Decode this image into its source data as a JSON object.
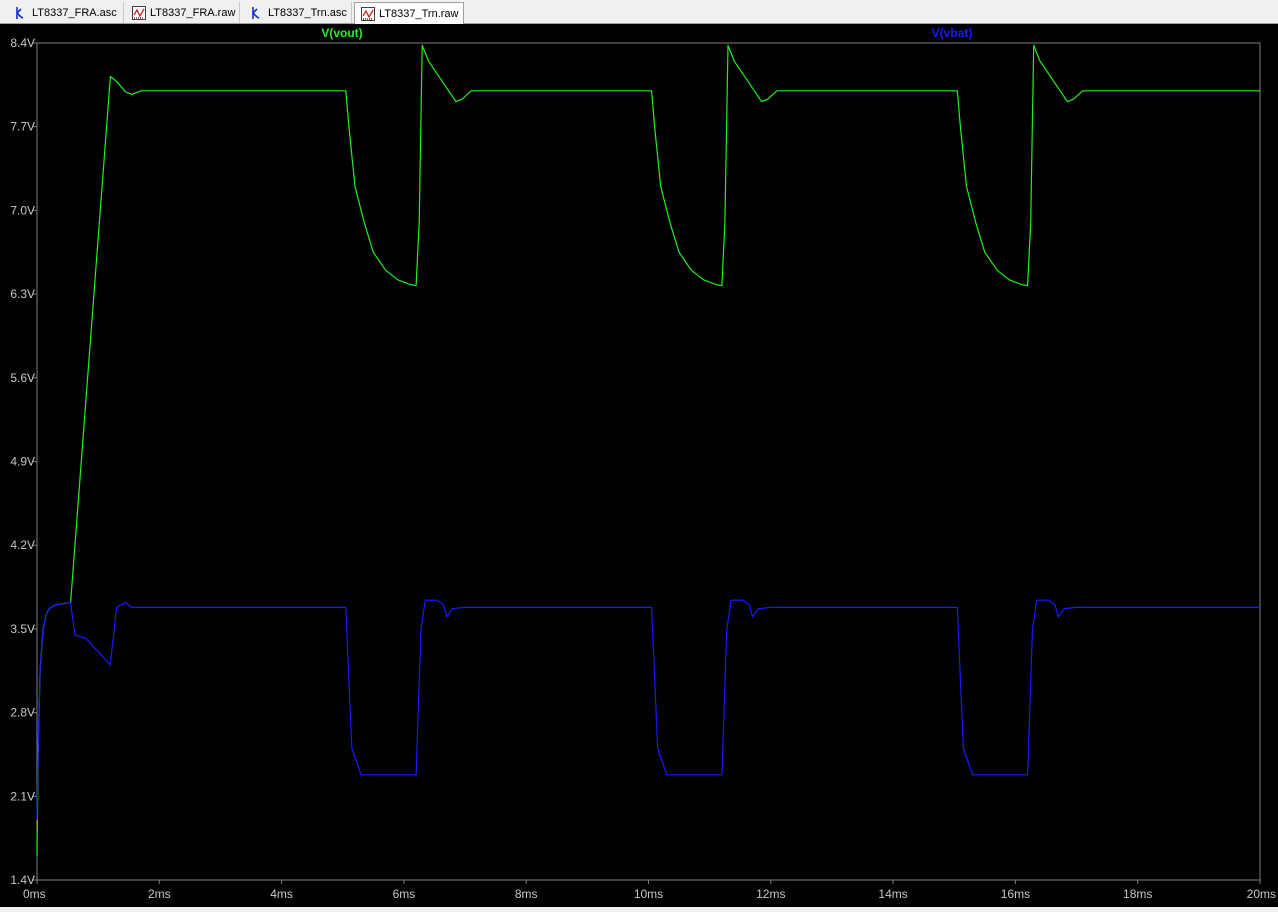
{
  "tabs": [
    {
      "label": "LT8337_FRA.asc",
      "icon": "schematic-icon"
    },
    {
      "label": "LT8337_FRA.raw",
      "icon": "waveform-icon"
    },
    {
      "label": "LT8337_Trn.asc",
      "icon": "schematic-icon"
    },
    {
      "label": "LT8337_Trn.raw",
      "icon": "waveform-icon",
      "active": true
    }
  ],
  "colors": {
    "background": "#000000",
    "axis": "#808080",
    "vout": "#22ee22",
    "vbat": "#1a1aff",
    "label_text": "#c8c8c8"
  },
  "chart_data": {
    "type": "line",
    "title": "",
    "xlabel": "",
    "ylabel": "",
    "xlim": [
      0,
      20
    ],
    "ylim": [
      1.4,
      8.4
    ],
    "grid": false,
    "x_ticks": [
      "0ms",
      "2ms",
      "4ms",
      "6ms",
      "8ms",
      "10ms",
      "12ms",
      "14ms",
      "16ms",
      "18ms",
      "20ms"
    ],
    "y_ticks": [
      "1.4V",
      "2.1V",
      "2.8V",
      "3.5V",
      "4.2V",
      "4.9V",
      "5.6V",
      "6.3V",
      "7.0V",
      "7.7V",
      "8.4V"
    ],
    "series": [
      {
        "name": "V(vout)",
        "color": "#22ee22",
        "x": [
          0,
          0.02,
          0.05,
          0.1,
          0.15,
          0.2,
          0.3,
          0.4,
          0.55,
          1.2,
          1.3,
          1.45,
          1.55,
          1.7,
          2,
          5.05,
          5.1,
          5.2,
          5.35,
          5.5,
          5.7,
          5.9,
          6.1,
          6.2,
          6.25,
          6.3,
          6.4,
          6.6,
          6.85,
          6.95,
          7.1,
          8,
          10.05,
          10.1,
          10.2,
          10.35,
          10.5,
          10.7,
          10.9,
          11.1,
          11.2,
          11.25,
          11.3,
          11.4,
          11.6,
          11.85,
          11.95,
          12.1,
          13,
          15.05,
          15.1,
          15.2,
          15.35,
          15.5,
          15.7,
          15.9,
          16.1,
          16.2,
          16.25,
          16.3,
          16.4,
          16.6,
          16.85,
          16.95,
          17.1,
          20
        ],
        "y": [
          1.6,
          2.5,
          3.15,
          3.5,
          3.62,
          3.67,
          3.7,
          3.71,
          3.72,
          8.12,
          8.08,
          7.99,
          7.97,
          8.0,
          8.0,
          8.0,
          7.7,
          7.2,
          6.9,
          6.65,
          6.5,
          6.42,
          6.38,
          6.37,
          6.9,
          8.38,
          8.25,
          8.1,
          7.91,
          7.93,
          8.0,
          8.0,
          8.0,
          7.7,
          7.2,
          6.9,
          6.65,
          6.5,
          6.42,
          6.38,
          6.37,
          6.9,
          8.38,
          8.25,
          8.1,
          7.91,
          7.93,
          8.0,
          8.0,
          8.0,
          7.7,
          7.2,
          6.9,
          6.65,
          6.5,
          6.42,
          6.38,
          6.37,
          6.9,
          8.38,
          8.25,
          8.1,
          7.91,
          7.93,
          8.0,
          8.0
        ]
      },
      {
        "name": "V(vbat)",
        "color": "#1a1aff",
        "x": [
          0,
          0.02,
          0.05,
          0.1,
          0.15,
          0.2,
          0.3,
          0.4,
          0.55,
          0.58,
          0.62,
          0.8,
          1.2,
          1.3,
          1.45,
          1.55,
          2,
          5.05,
          5.15,
          5.3,
          5.5,
          6.1,
          6.2,
          6.28,
          6.35,
          6.55,
          6.65,
          6.7,
          6.8,
          7,
          10.05,
          10.15,
          10.3,
          10.5,
          11.1,
          11.2,
          11.28,
          11.35,
          11.55,
          11.65,
          11.7,
          11.8,
          12,
          15.05,
          15.15,
          15.3,
          15.5,
          16.1,
          16.2,
          16.28,
          16.35,
          16.55,
          16.65,
          16.7,
          16.8,
          17,
          20
        ],
        "y": [
          1.9,
          2.5,
          3.15,
          3.5,
          3.62,
          3.67,
          3.7,
          3.71,
          3.72,
          3.6,
          3.45,
          3.42,
          3.2,
          3.68,
          3.72,
          3.68,
          3.68,
          3.68,
          2.5,
          2.28,
          2.28,
          2.28,
          2.28,
          3.5,
          3.74,
          3.74,
          3.7,
          3.6,
          3.67,
          3.68,
          3.68,
          2.5,
          2.28,
          2.28,
          2.28,
          2.28,
          3.5,
          3.74,
          3.74,
          3.7,
          3.6,
          3.67,
          3.68,
          3.68,
          2.5,
          2.28,
          2.28,
          2.28,
          2.28,
          3.5,
          3.74,
          3.74,
          3.7,
          3.6,
          3.67,
          3.68,
          3.68
        ]
      }
    ]
  }
}
